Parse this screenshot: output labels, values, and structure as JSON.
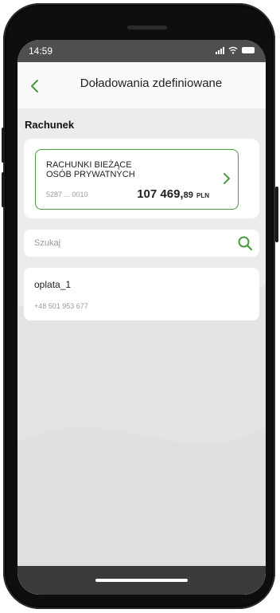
{
  "status_bar": {
    "time": "14:59",
    "icons": [
      "signal-icon",
      "wifi-icon",
      "battery-icon"
    ]
  },
  "header": {
    "back_icon": "chevron-left-icon",
    "title": "Doładowania zdefiniowane"
  },
  "account_section": {
    "label": "Rachunek",
    "account": {
      "name_line1": "RACHUNKI BIEŻĄCE",
      "name_line2": "OSÓB PRYWATNYCH",
      "number": "5287 ... 0010",
      "balance_int": "107 469,",
      "balance_frac": "89",
      "currency": "PLN",
      "chevron_icon": "chevron-right-icon"
    }
  },
  "search": {
    "placeholder": "Szukaj",
    "value": "",
    "icon": "search-icon"
  },
  "recharges": [
    {
      "name": "oplata_1",
      "phone": "+48 501 953 677"
    }
  ],
  "colors": {
    "accent": "#4a9a3e",
    "background": "#ececec",
    "card": "#ffffff"
  }
}
